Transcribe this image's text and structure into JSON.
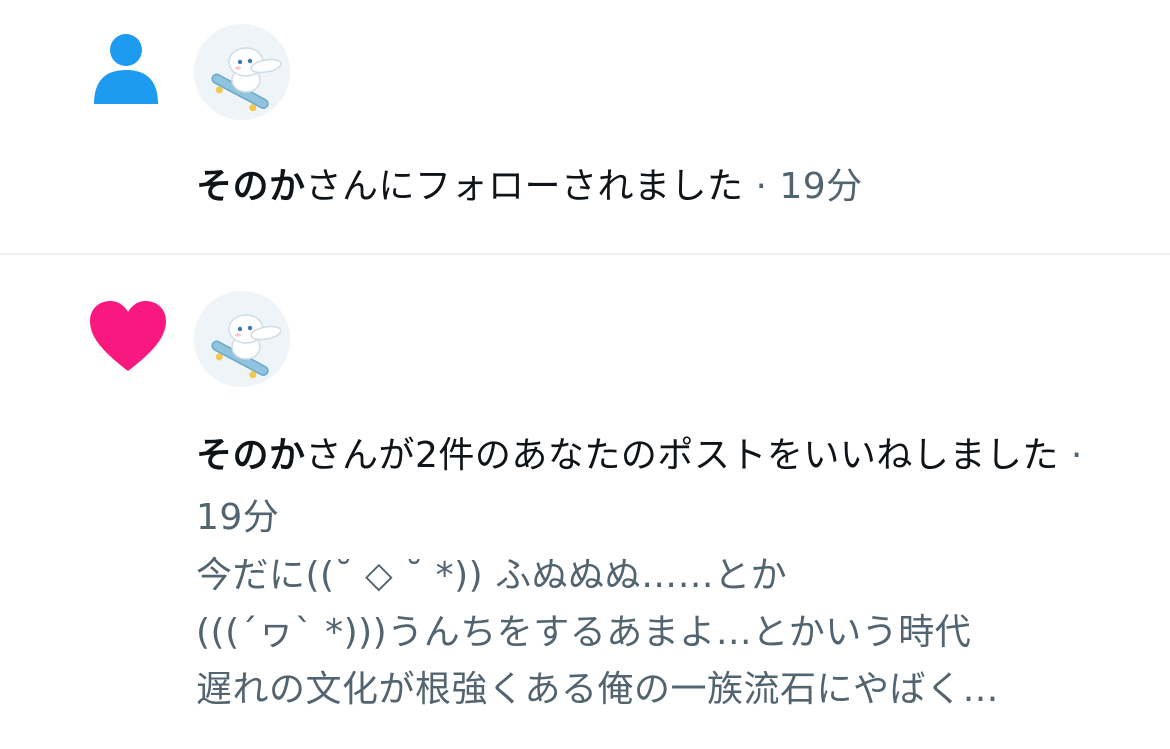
{
  "colors": {
    "follow_icon": "#1d9bf0",
    "like_icon": "#f91880",
    "text_primary": "#0f1419",
    "text_secondary": "#536471",
    "divider": "#eff3f4"
  },
  "notifications": [
    {
      "type": "follow",
      "icon": "person-icon",
      "avatar": "cinnamoroll-skateboard-avatar",
      "user_name": "そのか",
      "message": "さんにフォローされました",
      "separator": " · ",
      "time": "19分"
    },
    {
      "type": "like",
      "icon": "heart-icon",
      "avatar": "cinnamoroll-skateboard-avatar",
      "user_name": "そのか",
      "message": "さんが2件のあなたのポストをいいねしました",
      "separator": " · ",
      "time": "19分",
      "post_preview_lines": [
        "今だに((˘ ◇ ˘ *)) ふぬぬぬ……とか",
        "(((´ヮ` *)))うんちをするあまよ…とかいう時代",
        "遅れの文化が根強くある俺の一族流石にやばく…"
      ]
    }
  ]
}
